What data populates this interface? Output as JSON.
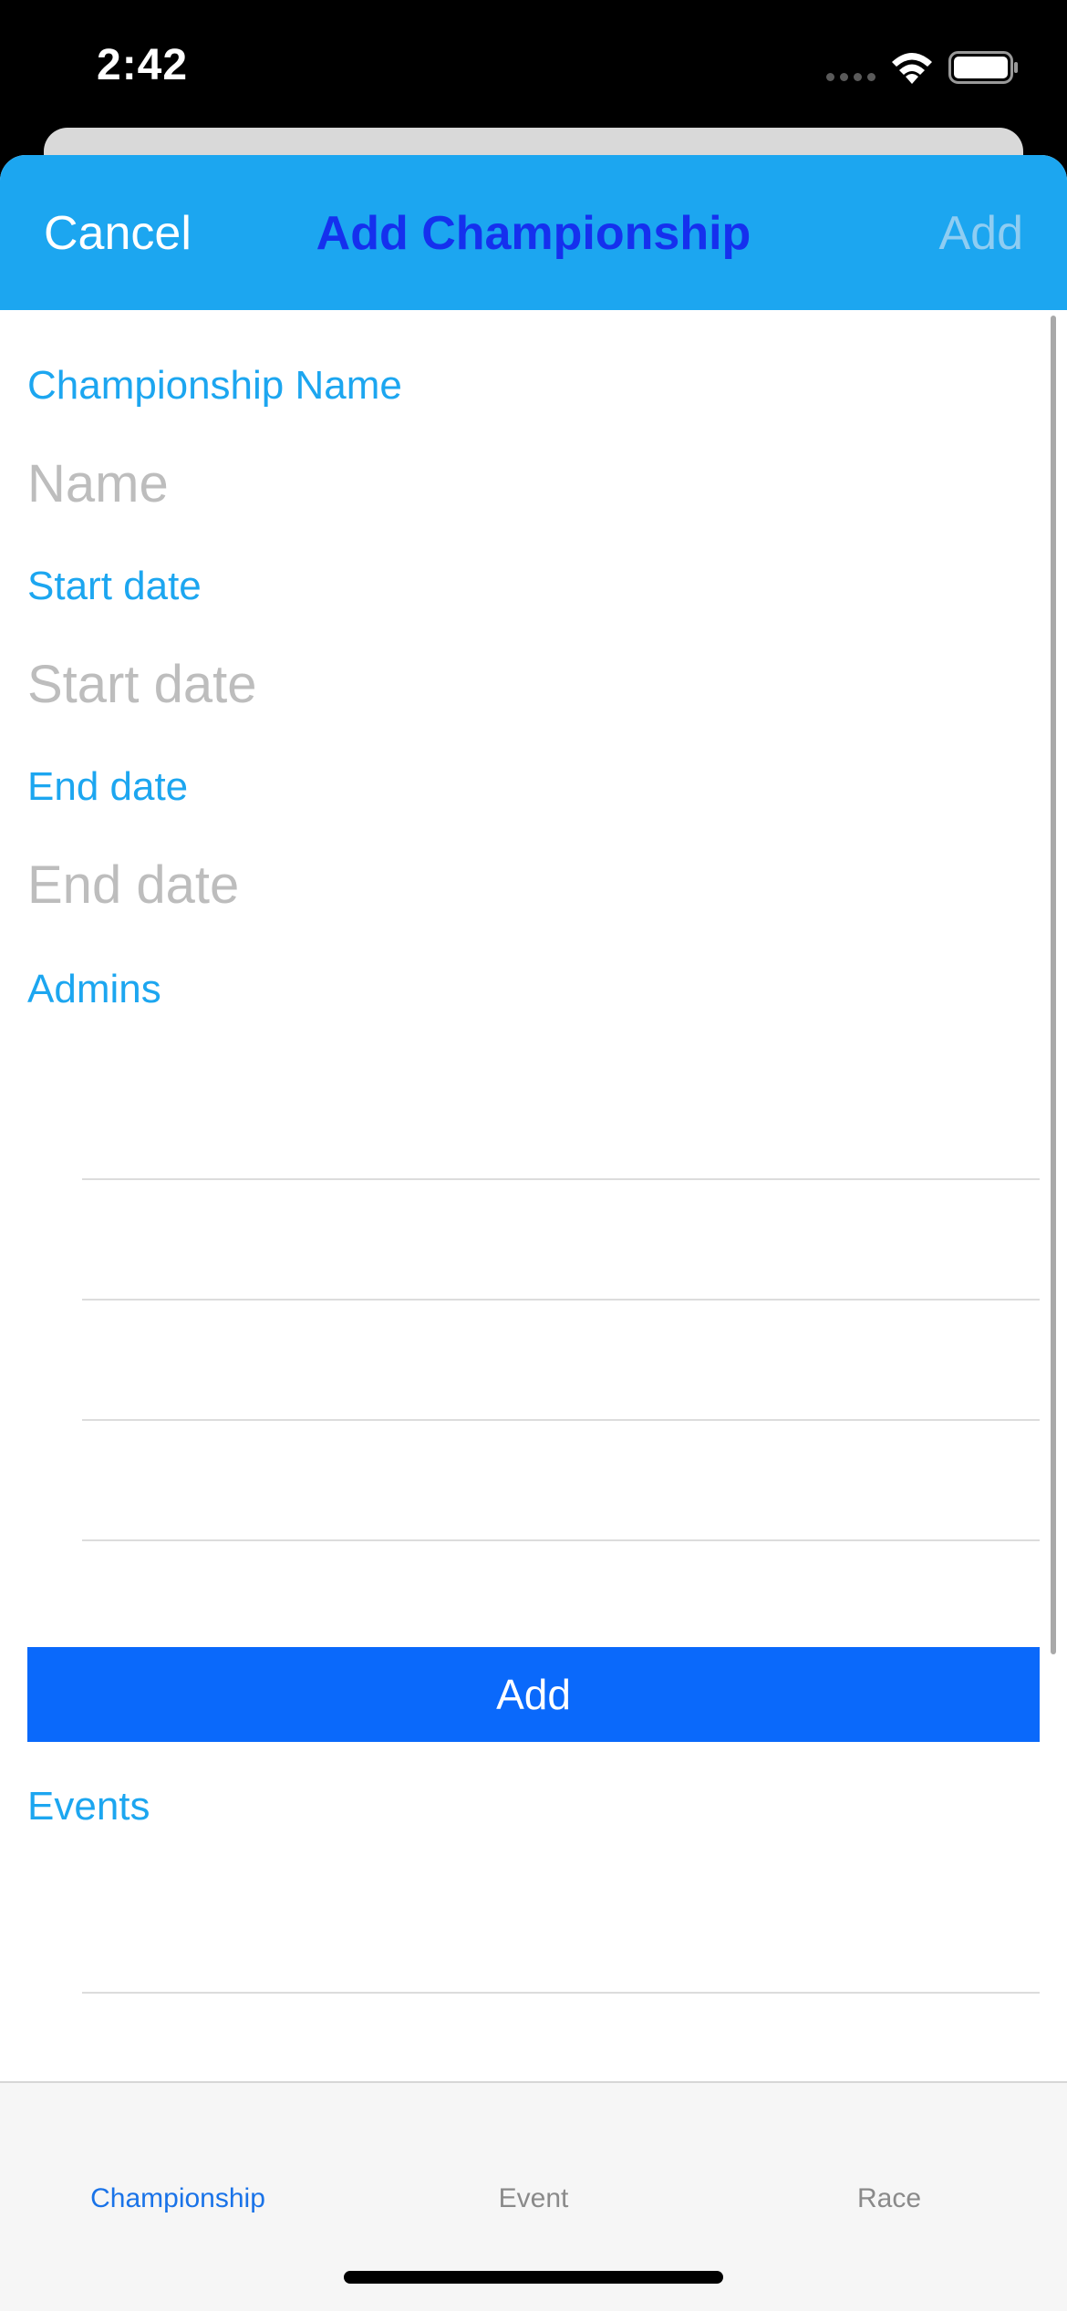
{
  "status_bar": {
    "time": "2:42",
    "icons": [
      "signal-icon",
      "wifi-icon",
      "battery-icon"
    ]
  },
  "nav": {
    "cancel_label": "Cancel",
    "title": "Add Championship",
    "add_label": "Add"
  },
  "form": {
    "name_label": "Championship Name",
    "name_placeholder": "Name",
    "name_value": "",
    "start_label": "Start date",
    "start_placeholder": "Start date",
    "start_value": "",
    "end_label": "End date",
    "end_placeholder": "End date",
    "end_value": "",
    "admins_label": "Admins",
    "add_admin_label": "Add",
    "events_label": "Events"
  },
  "tabs": [
    {
      "label": "Championship",
      "active": true
    },
    {
      "label": "Event",
      "active": false
    },
    {
      "label": "Race",
      "active": false
    }
  ],
  "colors": {
    "accent": "#1ca6f0",
    "title": "#1530ee",
    "button": "#0a69fb",
    "tab_active": "#1a73e8"
  }
}
